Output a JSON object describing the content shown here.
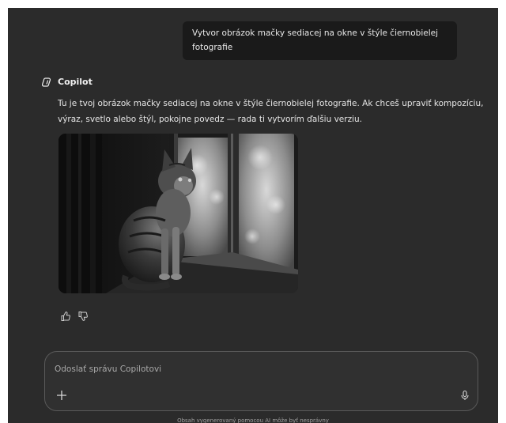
{
  "user_message": {
    "text": "Vytvor obrázok mačky sediacej na okne v štýle čiernobielej fotografie"
  },
  "assistant": {
    "name": "Copilot",
    "logo_icon": "copilot-logo-icon",
    "reply": "Tu je tvoj obrázok mačky sediacej na okne v štýle čiernobielej fotografie. Ak chceš upraviť kompozíciu, výraz, svetlo alebo štýl, pokojne povedz — rada ti vytvorím ďalšiu verziu.",
    "image_icon": "generated-cat-image",
    "feedback": {
      "like_icon": "thumbs-up-icon",
      "dislike_icon": "thumbs-down-icon"
    }
  },
  "composer": {
    "placeholder": "Odoslať správu Copilotovi",
    "value": "",
    "add_icon": "plus-icon",
    "mic_icon": "microphone-icon"
  },
  "disclaimer": "Obsah vygenerovaný pomocou AI môže byť nesprávny",
  "colors": {
    "background": "#2b2b2b",
    "user_bubble": "#1a1a1a",
    "text": "#e6e6e6"
  }
}
